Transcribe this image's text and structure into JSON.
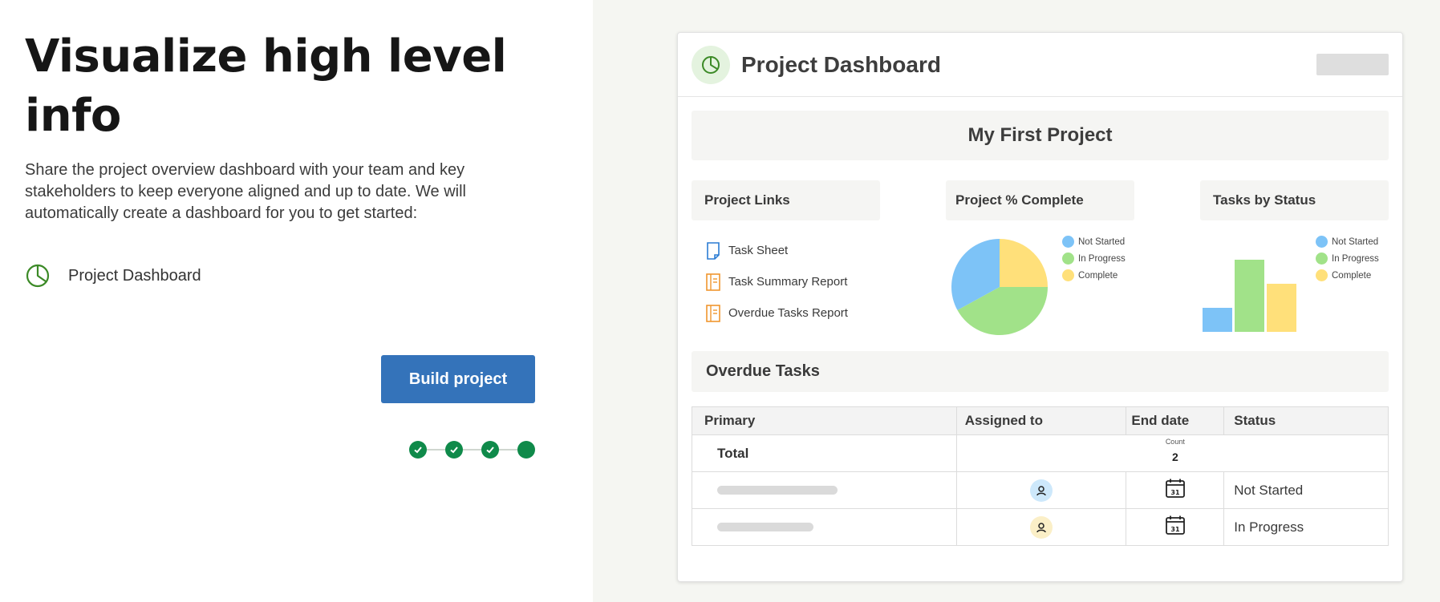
{
  "left": {
    "headline": "Visualize high level info",
    "description": "Share the project overview dashboard with your team and key stakeholders to keep everyone aligned and up to date. We will automatically create a dashboard for you to get started:",
    "dashboard_link_label": "Project Dashboard",
    "build_button_label": "Build project",
    "steps_completed": 3,
    "steps_total": 4
  },
  "dashboard": {
    "title": "Project Dashboard",
    "project_name": "My First Project",
    "links_section_title": "Project Links",
    "links": [
      {
        "label": "Task Sheet",
        "icon": "sheet-icon"
      },
      {
        "label": "Task Summary Report",
        "icon": "report-icon"
      },
      {
        "label": "Overdue Tasks Report",
        "icon": "report-icon"
      }
    ],
    "pie_section_title": "Project % Complete",
    "bar_section_title": "Tasks by Status",
    "overdue_title": "Overdue Tasks",
    "table": {
      "headers": [
        "Primary",
        "Assigned to",
        "End date",
        "Status"
      ],
      "total_label": "Total",
      "count_label": "Count",
      "count_value": "2",
      "rows": [
        {
          "status": "Not Started",
          "avatar_color": "#cde8fb"
        },
        {
          "status": "In Progress",
          "avatar_color": "#fbefc7"
        }
      ]
    }
  },
  "colors": {
    "accent": "#3473ba",
    "step_green": "#0f8a4a",
    "not_started": "#7dc3f7",
    "in_progress": "#a1e289",
    "complete": "#ffe07a"
  },
  "chart_data": [
    {
      "type": "pie",
      "title": "Project % Complete",
      "categories": [
        "Not Started",
        "In Progress",
        "Complete"
      ],
      "values": [
        33,
        42,
        25
      ]
    },
    {
      "type": "bar",
      "title": "Tasks by Status",
      "categories": [
        "Not Started",
        "In Progress",
        "Complete"
      ],
      "values": [
        1,
        3,
        2
      ],
      "ylim": [
        0,
        3
      ]
    }
  ]
}
